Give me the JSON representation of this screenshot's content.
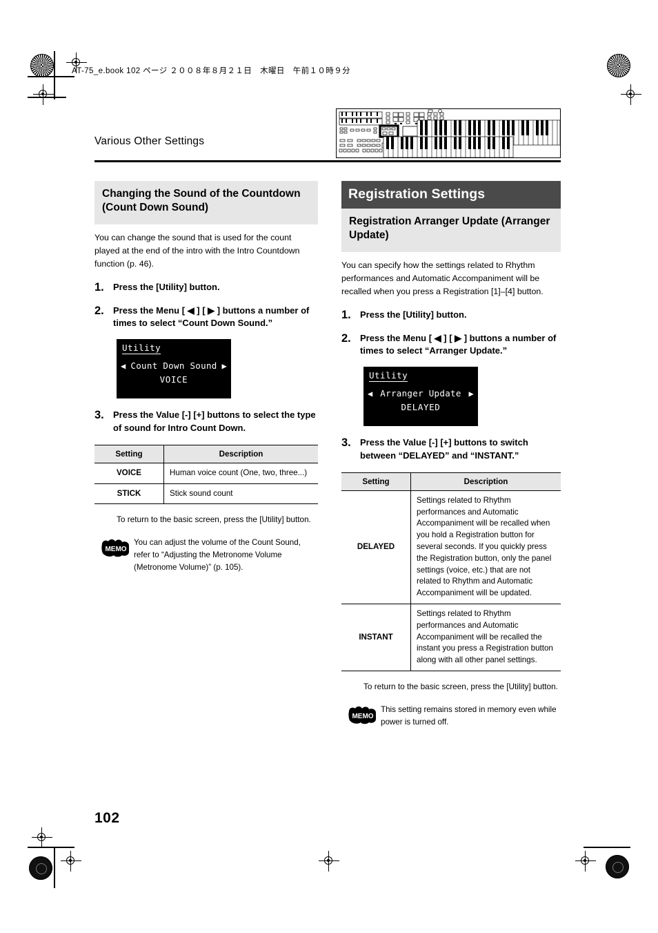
{
  "print_header": "AT-75_e.book  102 ページ  ２００８年８月２１日　木曜日　午前１０時９分",
  "running_head": "Various Other Settings",
  "folio": "102",
  "left_column": {
    "heading": "Changing the Sound of the Countdown (Count Down Sound)",
    "intro": "You can change the sound that is used for the count played at the end of the intro with the Intro Countdown function (p. 46).",
    "steps": [
      {
        "num": "1.",
        "text": "Press the [Utility] button."
      },
      {
        "num": "2.",
        "text": "Press the Menu [ ◀ ] [ ▶ ] buttons a number of times to select “Count Down Sound.”"
      },
      {
        "num": "3.",
        "text": "Press the Value [-] [+] buttons to select the type of sound for Intro Count Down."
      }
    ],
    "lcd": {
      "title": "Utility",
      "left_arrow": "◀",
      "parameter": "Count Down Sound",
      "right_arrow": "▶",
      "value": "VOICE"
    },
    "table": {
      "headers": [
        "Setting",
        "Description"
      ],
      "rows": [
        {
          "setting": "VOICE",
          "description": "Human voice count (One, two, three...)"
        },
        {
          "setting": "STICK",
          "description": "Stick sound count"
        }
      ]
    },
    "return_note": "To return to the basic screen, press the [Utility] button.",
    "memo": {
      "icon_label": "MEMO",
      "text": "You can adjust the volume of the Count Sound, refer to “Adjusting the Metronome Volume (Metronome Volume)” (p. 105)."
    }
  },
  "right_column": {
    "section_bar": "Registration Settings",
    "heading": "Registration Arranger Update (Arranger Update)",
    "intro": "You can specify how the settings related to Rhythm performances and Automatic Accompaniment will be recalled when you press a Registration [1]–[4] button.",
    "steps": [
      {
        "num": "1.",
        "text": "Press the [Utility] button."
      },
      {
        "num": "2.",
        "text": "Press the Menu [ ◀ ] [ ▶ ] buttons a number of times to select “Arranger Update.”"
      },
      {
        "num": "3.",
        "text": "Press the Value [-] [+] buttons to switch between “DELAYED” and “INSTANT.”"
      }
    ],
    "lcd": {
      "title": "Utility",
      "left_arrow": "◀",
      "parameter": "Arranger Update",
      "right_arrow": "▶",
      "value": "DELAYED"
    },
    "table": {
      "headers": [
        "Setting",
        "Description"
      ],
      "rows": [
        {
          "setting": "DELAYED",
          "description": "Settings related to Rhythm performances and Automatic Accompaniment will be recalled when you hold a Registration button for several seconds. If you quickly press the Registration button, only the panel settings (voice, etc.) that are not related to Rhythm and Automatic Accompaniment will be updated."
        },
        {
          "setting": "INSTANT",
          "description": "Settings related to Rhythm performances and Automatic Accompaniment will be recalled the instant you press a Registration button along with all other panel settings."
        }
      ]
    },
    "return_note": "To return to the basic screen, press the [Utility] button.",
    "memo": {
      "icon_label": "MEMO",
      "text": "This setting remains stored in memory even while power is turned off."
    }
  },
  "illustration": {
    "name": "organ-panel-diagram",
    "highlight": "utility-button-group"
  }
}
